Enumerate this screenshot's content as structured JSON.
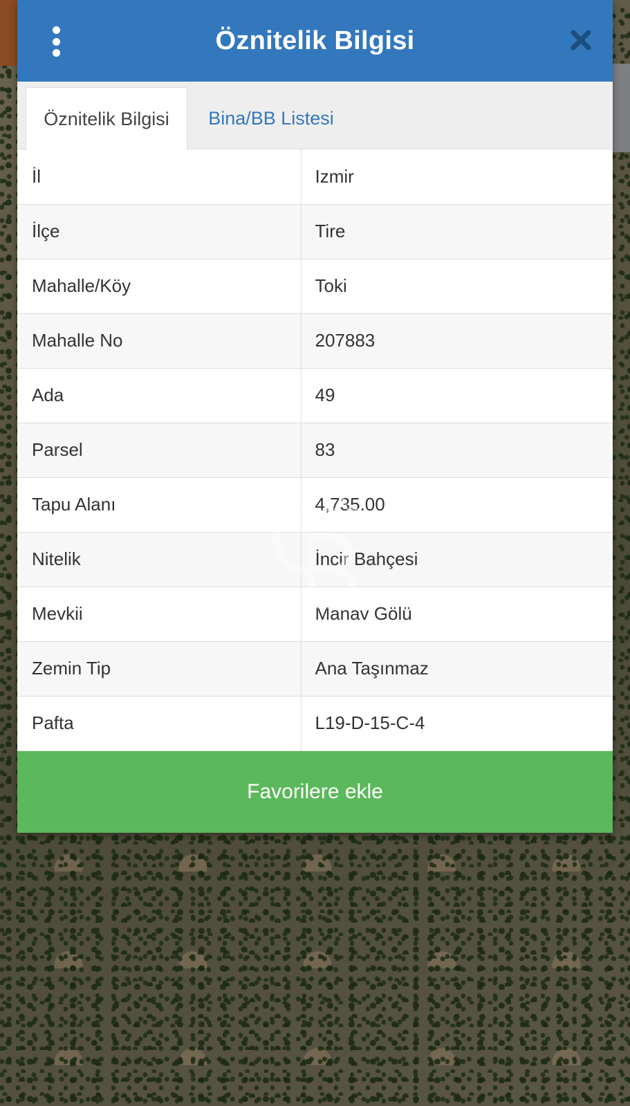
{
  "header": {
    "title": "Öznitelik Bilgisi"
  },
  "tabs": [
    {
      "label": "Öznitelik Bilgisi",
      "active": true
    },
    {
      "label": "Bina/BB Listesi",
      "active": false
    }
  ],
  "attributes": [
    {
      "key": "İl",
      "value": "Izmir"
    },
    {
      "key": "İlçe",
      "value": "Tire"
    },
    {
      "key": "Mahalle/Köy",
      "value": "Toki"
    },
    {
      "key": "Mahalle No",
      "value": "207883"
    },
    {
      "key": "Ada",
      "value": "49"
    },
    {
      "key": "Parsel",
      "value": "83"
    },
    {
      "key": "Tapu Alanı",
      "value": "4,735.00"
    },
    {
      "key": "Nitelik",
      "value": "İncir Bahçesi"
    },
    {
      "key": "Mevkii",
      "value": "Manav Gölü"
    },
    {
      "key": "Zemin Tip",
      "value": "Ana Taşınmaz"
    },
    {
      "key": "Pafta",
      "value": "L19-D-15-C-4"
    }
  ],
  "actions": {
    "favorite_label": "Favorilere ekle"
  },
  "icons": {
    "menu": "vertical-dots-icon",
    "close": "close-icon",
    "watermark": "logo-watermark"
  },
  "colors": {
    "header": "#3378bd",
    "tab_link": "#3378bd",
    "favorite_button": "#5cb85c"
  }
}
